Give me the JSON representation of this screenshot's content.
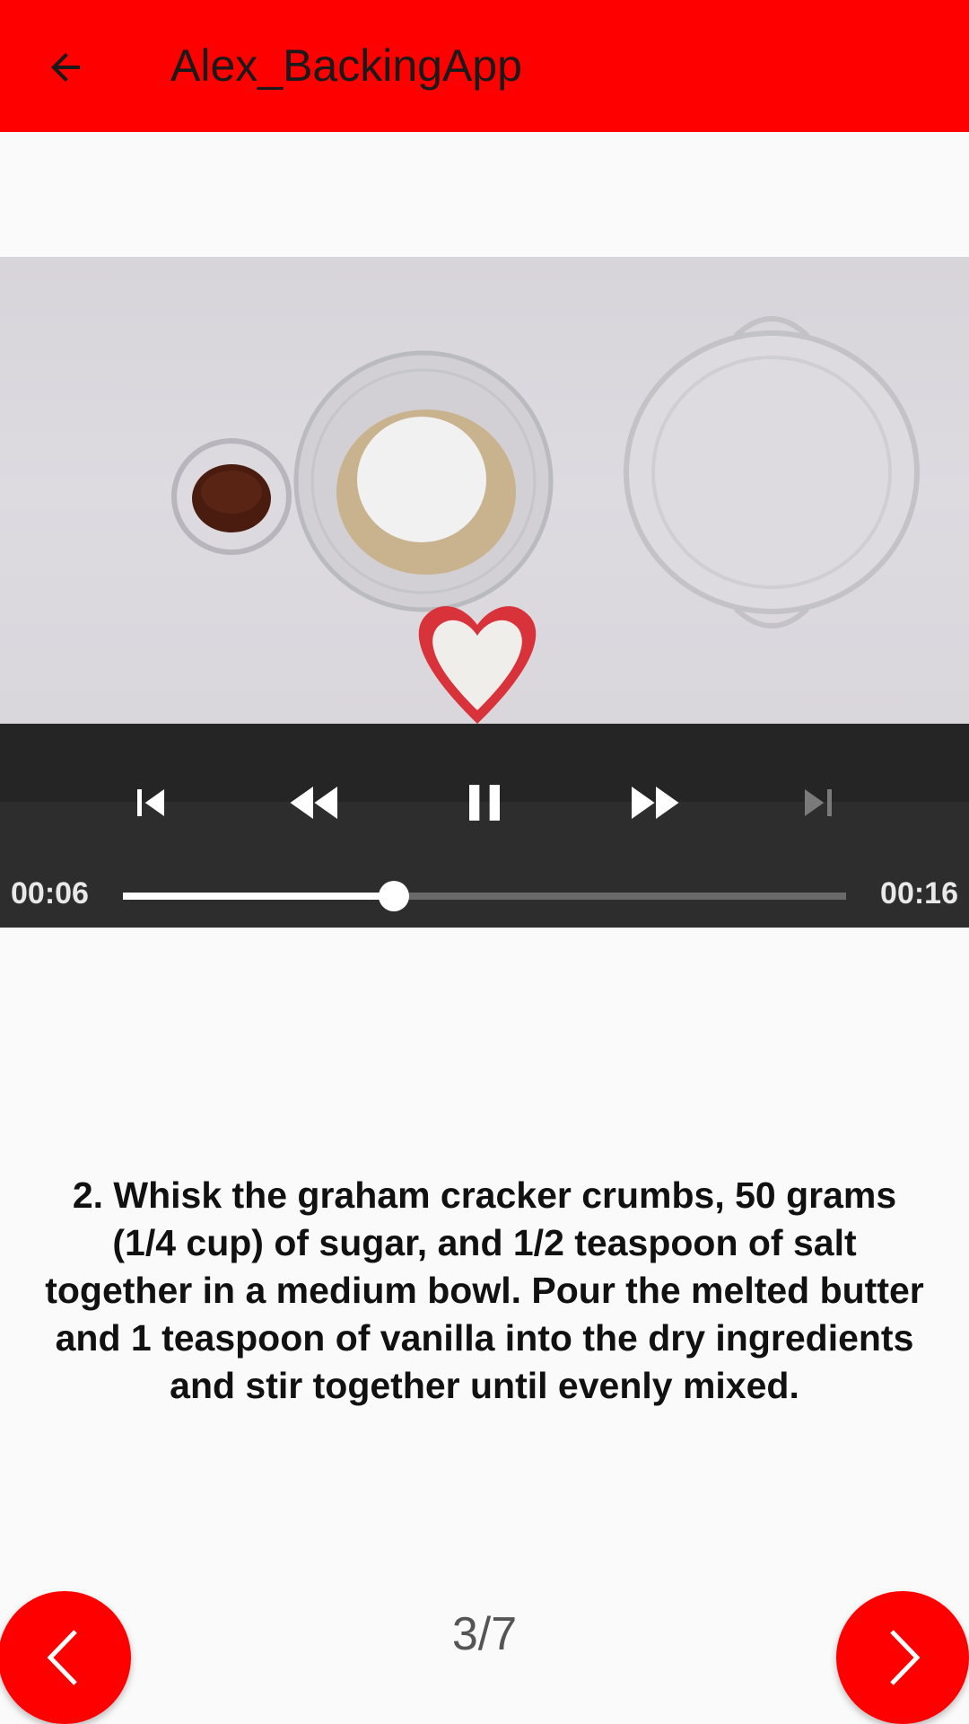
{
  "app_bar": {
    "title": "Alex_BackingApp",
    "back_icon": "arrow-left-icon",
    "background_color": "#ff0000"
  },
  "player": {
    "position": "00:06",
    "duration": "00:16",
    "progress_fraction": 0.375,
    "controls": {
      "previous_icon": "skip-previous-icon",
      "rewind_icon": "rewind-icon",
      "pause_icon": "pause-icon",
      "fast_forward_icon": "fast-forward-icon",
      "next_icon": "skip-next-icon"
    }
  },
  "step": {
    "description": "2. Whisk the graham cracker crumbs, 50 grams (1/4 cup) of sugar, and 1/2 teaspoon of salt together in a medium bowl. Pour the melted butter and 1 teaspoon of vanilla into the dry ingredients and stir together until evenly mixed."
  },
  "navigation": {
    "page": "3/7",
    "prev_icon": "chevron-left-icon",
    "next_icon": "chevron-right-icon"
  }
}
